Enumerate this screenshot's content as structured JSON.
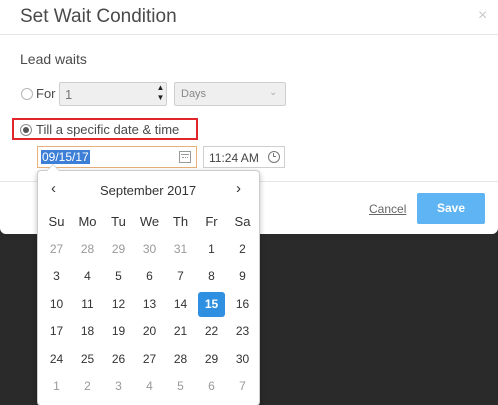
{
  "dialog": {
    "title": "Set Wait Condition",
    "close_glyph": "×"
  },
  "form": {
    "section_label": "Lead waits",
    "for_option": {
      "label": "For",
      "checked": false
    },
    "duration": {
      "value": "1"
    },
    "units": {
      "selected": "Days"
    },
    "till_option": {
      "label": "Till a specific date & time",
      "checked": true
    },
    "date_field": {
      "value": "09/15/17"
    },
    "time_field": {
      "value": "11:24 AM"
    }
  },
  "footer": {
    "cancel_label": "Cancel",
    "save_label": "Save"
  },
  "datepicker": {
    "month_label": "September 2017",
    "prev_glyph": "‹",
    "next_glyph": "›",
    "weekdays": [
      "Su",
      "Mo",
      "Tu",
      "We",
      "Th",
      "Fr",
      "Sa"
    ],
    "weeks": [
      [
        "27",
        "28",
        "29",
        "30",
        "31",
        "1",
        "2"
      ],
      [
        "3",
        "4",
        "5",
        "6",
        "7",
        "8",
        "9"
      ],
      [
        "10",
        "11",
        "12",
        "13",
        "14",
        "15",
        "16"
      ],
      [
        "17",
        "18",
        "19",
        "20",
        "21",
        "22",
        "23"
      ],
      [
        "24",
        "25",
        "26",
        "27",
        "28",
        "29",
        "30"
      ],
      [
        "1",
        "2",
        "3",
        "4",
        "5",
        "6",
        "7"
      ]
    ],
    "selected_day": "15"
  },
  "colors": {
    "accent": "#2f8fe0",
    "save_button": "#5fb4f3",
    "highlight_border": "#e0262b",
    "date_selection": "#3d7fd6"
  },
  "icons": [
    "close-icon",
    "stepper-icon",
    "chevron-down-icon",
    "calendar-icon",
    "clock-icon"
  ]
}
